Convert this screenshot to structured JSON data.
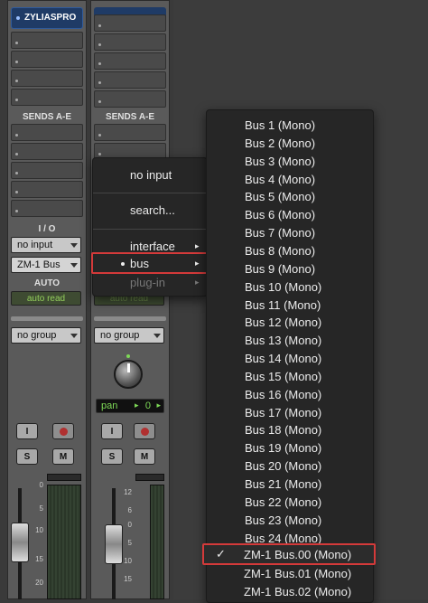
{
  "track1": {
    "name": "ZYLIASPRO",
    "sends_label": "SENDS A-E",
    "io_label": "I / O",
    "input": "no input",
    "output": "ZM-1 Bus",
    "auto_label": "AUTO",
    "auto_mode": "auto read",
    "group": "no group",
    "btn_input": "I",
    "btn_solo": "S",
    "btn_mute": "M",
    "scale": [
      "0",
      "5",
      "10",
      "15",
      "20"
    ]
  },
  "track2": {
    "sends_label": "SENDS A-E",
    "auto_mode": "auto read",
    "group": "no group",
    "pan_label": "pan",
    "pan_value": "0",
    "btn_input": "I",
    "btn_solo": "S",
    "btn_mute": "M",
    "scale": [
      "12",
      "6",
      "0",
      "5",
      "10",
      "15"
    ]
  },
  "context_menu": {
    "no_input": "no input",
    "search": "search...",
    "interface": "interface",
    "bus": "bus",
    "plugin": "plug-in"
  },
  "bus_menu": {
    "items": [
      "Bus 1 (Mono)",
      "Bus 2 (Mono)",
      "Bus 3 (Mono)",
      "Bus 4 (Mono)",
      "Bus 5 (Mono)",
      "Bus 6 (Mono)",
      "Bus 7 (Mono)",
      "Bus 8 (Mono)",
      "Bus 9 (Mono)",
      "Bus 10 (Mono)",
      "Bus 11 (Mono)",
      "Bus 12 (Mono)",
      "Bus 13 (Mono)",
      "Bus 14 (Mono)",
      "Bus 15 (Mono)",
      "Bus 16 (Mono)",
      "Bus 17 (Mono)",
      "Bus 18 (Mono)",
      "Bus 19 (Mono)",
      "Bus 20 (Mono)",
      "Bus 21 (Mono)",
      "Bus 22 (Mono)",
      "Bus 23 (Mono)",
      "Bus 24 (Mono)"
    ],
    "selected": "ZM-1 Bus.00 (Mono)",
    "check": "✓",
    "after": [
      "ZM-1 Bus.01 (Mono)",
      "ZM-1 Bus.02 (Mono)"
    ]
  },
  "colors": {
    "highlight": "#d43a3a",
    "auto_text": "#94d05c",
    "track_name_bg": "#1f3b66"
  }
}
